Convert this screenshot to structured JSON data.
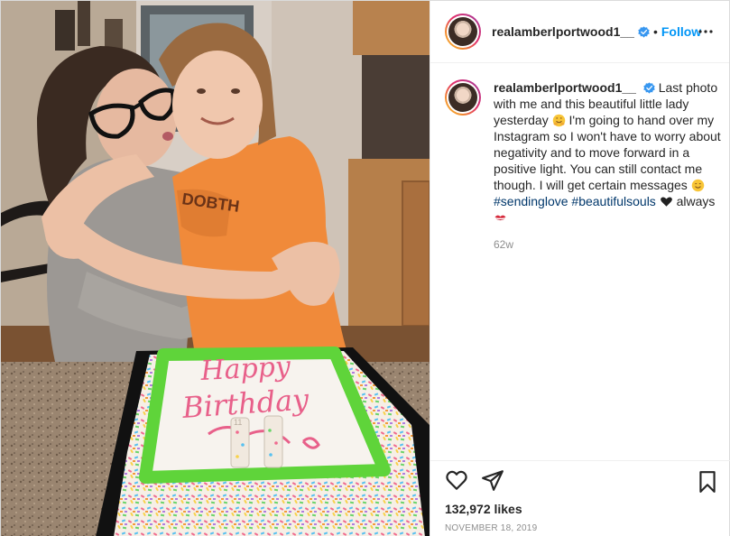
{
  "post": {
    "username": "realamberlportwood1__",
    "follow_label": "Follow",
    "separator": "•",
    "caption": {
      "username": "realamberlportwood1__",
      "part1": "Last photo with me and this beautiful little lady yesterday",
      "part2": "I'm going to hand over my Instagram so I won't have to worry about negativity and to move forward in a positive light. You can still contact me though. I will get certain messages",
      "hashtag1": "#sendinglove",
      "hashtag2": "#beautifulsouls",
      "part3": "always"
    },
    "time_ago": "62w",
    "likes": "132,972 likes",
    "date": "NOVEMBER 18, 2019"
  },
  "photo": {
    "cake_text_line1": "Happy",
    "cake_text_line2": "Birthday",
    "candle_number": "11"
  },
  "colors": {
    "follow_blue": "#0095f6",
    "hashtag_blue": "#00376b",
    "muted_gray": "#8e8e8e",
    "verified_blue": "#3897f0",
    "cake_green": "#5fd43a",
    "cake_pink": "#e8608a"
  },
  "icons": {
    "header_more": "more-horizontal-icon",
    "like": "heart-outline-icon",
    "share": "paper-plane-icon",
    "save": "bookmark-icon",
    "verified": "verified-badge-icon"
  }
}
